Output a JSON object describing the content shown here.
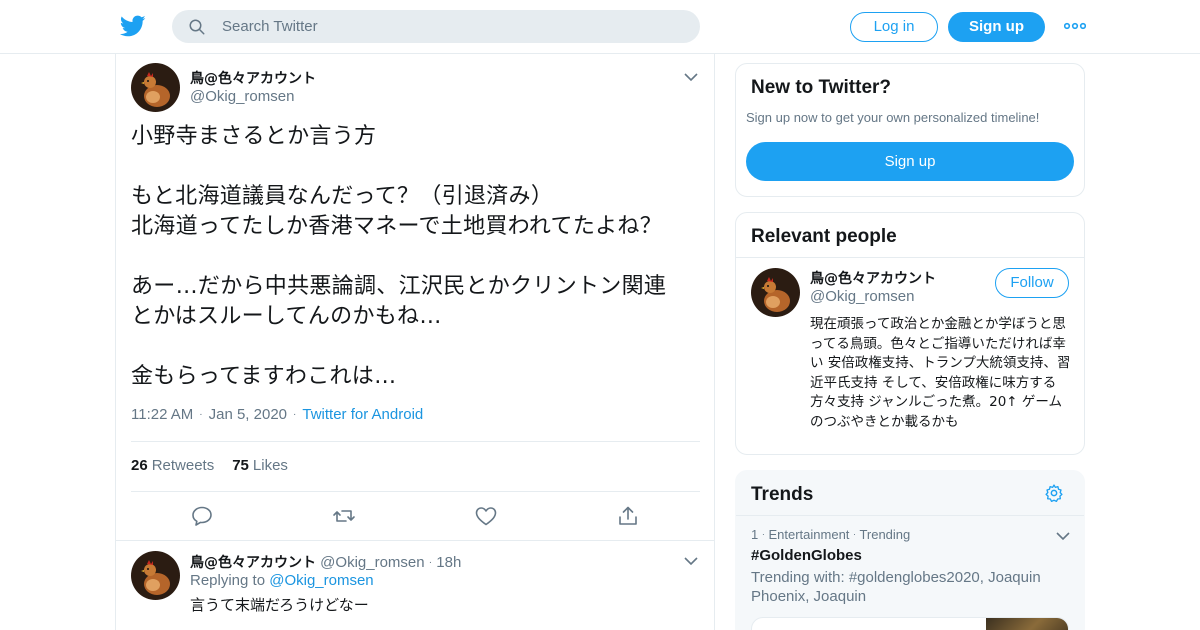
{
  "header": {
    "search_placeholder": "Search Twitter",
    "login_label": "Log in",
    "signup_label": "Sign up",
    "accent_color": "#1da1f2"
  },
  "tweet": {
    "author_name": "鳥@色々アカウント",
    "author_handle": "@Okig_romsen",
    "text": "小野寺まさるとか言う方\n\nもと北海道議員なんだって？（引退済み）\n北海道ってたしか香港マネーで土地買われてたよね？\n\nあー…だから中共悪論調、江沢民とかクリントン関連\nとかはスルーしてんのかもね…\n\n金もらってますわこれは…",
    "time": "11:22 AM",
    "date": "Jan 5, 2020",
    "source": "Twitter for Android",
    "retweets_count": "26",
    "retweets_label": "Retweets",
    "likes_count": "75",
    "likes_label": "Likes"
  },
  "reply": {
    "author_name": "鳥@色々アカウント",
    "author_handle": "@Okig_romsen",
    "age": "18h",
    "replying_prefix": "Replying to",
    "replying_handle": "@Okig_romsen",
    "text": "言うて末端だろうけどなー"
  },
  "sidebar": {
    "new_to_twitter": {
      "title": "New to Twitter?",
      "subtitle": "Sign up now to get your own personalized timeline!",
      "signup_label": "Sign up"
    },
    "relevant_people": {
      "title": "Relevant people",
      "name": "鳥@色々アカウント",
      "handle": "@Okig_romsen",
      "follow_label": "Follow",
      "bio": "現在頑張って政治とか金融とか学ぼうと思ってる鳥頭。色々とご指導いただければ幸い 安倍政権支持、トランプ大統領支持、習近平氏支持 そして、安倍政権に味方する方々支持 ジャンルごった煮。20↑ ゲームのつぶやきとか載るかも"
    },
    "trends": {
      "title": "Trends",
      "items": [
        {
          "rank": "1",
          "category": "Entertainment",
          "status": "Trending",
          "name": "#GoldenGlobes",
          "trending_with": "Trending with: #goldenglobes2020, Joaquin Phoenix, Joaquin"
        }
      ]
    }
  }
}
